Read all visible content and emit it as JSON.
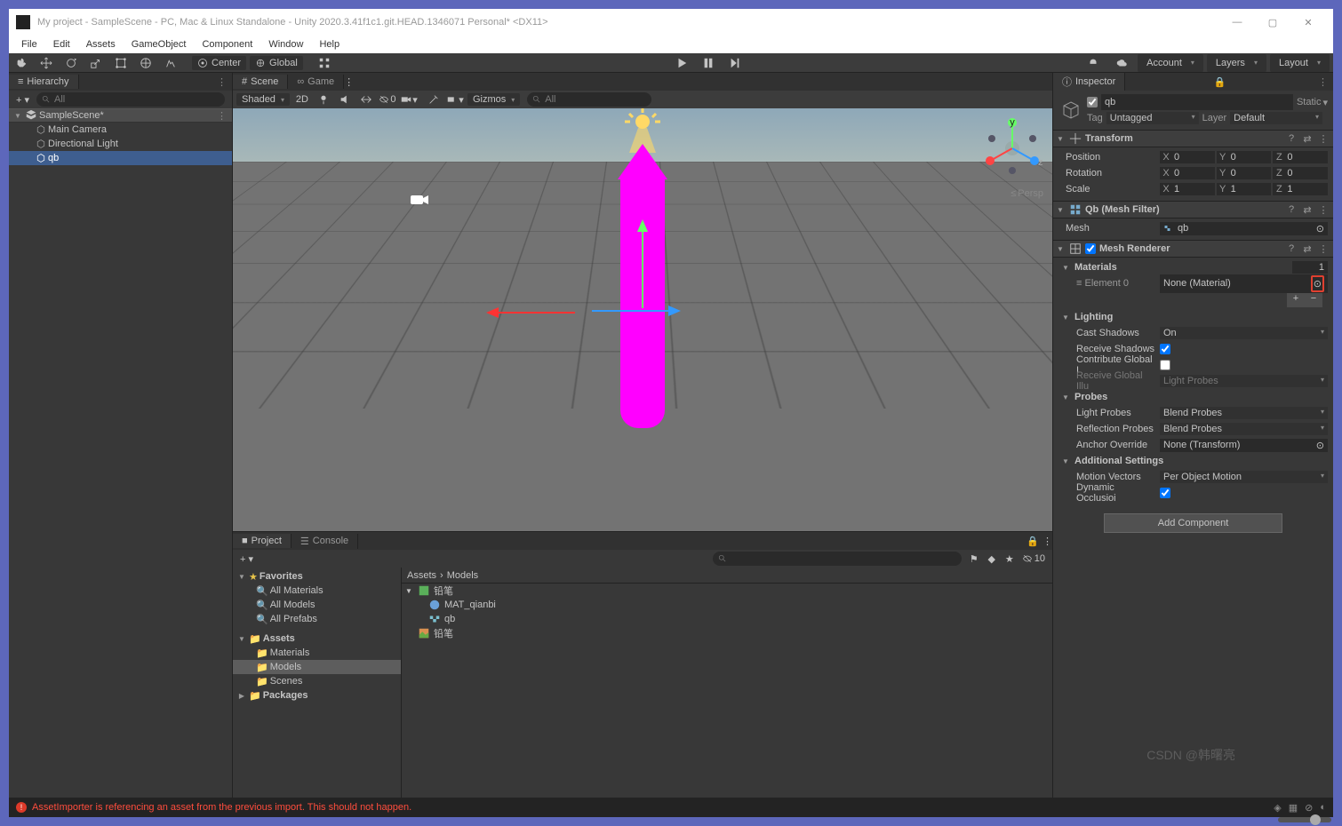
{
  "window": {
    "title": "My project - SampleScene - PC, Mac & Linux Standalone - Unity 2020.3.41f1c1.git.HEAD.1346071 Personal* <DX11>"
  },
  "menu": [
    "File",
    "Edit",
    "Assets",
    "GameObject",
    "Component",
    "Window",
    "Help"
  ],
  "toolbar": {
    "pivot": "Center",
    "handle": "Global",
    "account": "Account",
    "layers": "Layers",
    "layout": "Layout"
  },
  "hierarchy": {
    "tab": "Hierarchy",
    "search_placeholder": "All",
    "scene": "SampleScene*",
    "items": [
      "Main Camera",
      "Directional Light",
      "qb"
    ],
    "selected": 2
  },
  "scene": {
    "tab_scene": "Scene",
    "tab_game": "Game",
    "shading": "Shaded",
    "btn_2d": "2D",
    "gizmos": "Gizmos",
    "search_placeholder": "All",
    "persp": "Persp",
    "gizmo_count": "0"
  },
  "project": {
    "tab_project": "Project",
    "tab_console": "Console",
    "count_badge": "10",
    "favorites": "Favorites",
    "fav_items": [
      "All Materials",
      "All Models",
      "All Prefabs"
    ],
    "assets": "Assets",
    "asset_folders": [
      "Materials",
      "Models",
      "Scenes"
    ],
    "selected_folder": 1,
    "packages": "Packages",
    "breadcrumb": [
      "Assets",
      "Models"
    ],
    "content_root": "铅笔",
    "content_items": [
      "MAT_qianbi",
      "qb",
      "铅笔"
    ]
  },
  "status": {
    "error": "AssetImporter is referencing an asset from the previous import. This should not happen."
  },
  "inspector": {
    "tab": "Inspector",
    "name": "qb",
    "static": "Static",
    "tag_label": "Tag",
    "tag_value": "Untagged",
    "layer_label": "Layer",
    "layer_value": "Default",
    "transform": {
      "title": "Transform",
      "position": "Position",
      "rotation": "Rotation",
      "scale": "Scale",
      "pos": {
        "x": "0",
        "y": "0",
        "z": "0"
      },
      "rot": {
        "x": "0",
        "y": "0",
        "z": "0"
      },
      "scl": {
        "x": "1",
        "y": "1",
        "z": "1"
      }
    },
    "mesh_filter": {
      "title": "Qb (Mesh Filter)",
      "mesh_label": "Mesh",
      "mesh_value": "qb"
    },
    "mesh_renderer": {
      "title": "Mesh Renderer",
      "materials": "Materials",
      "materials_count": "1",
      "element0_label": "Element 0",
      "element0_value": "None (Material)",
      "lighting": "Lighting",
      "cast_shadows_label": "Cast Shadows",
      "cast_shadows_value": "On",
      "receive_shadows": "Receive Shadows",
      "contribute_gi": "Contribute Global I",
      "receive_gi_label": "Receive Global Illu",
      "receive_gi_value": "Light Probes",
      "probes": "Probes",
      "light_probes_label": "Light Probes",
      "light_probes_value": "Blend Probes",
      "reflection_label": "Reflection Probes",
      "reflection_value": "Blend Probes",
      "anchor_label": "Anchor Override",
      "anchor_value": "None (Transform)",
      "additional": "Additional Settings",
      "motion_label": "Motion Vectors",
      "motion_value": "Per Object Motion",
      "dynamic_occ": "Dynamic Occlusioi"
    },
    "add_component": "Add Component"
  },
  "watermark": "CSDN @韩曙亮"
}
